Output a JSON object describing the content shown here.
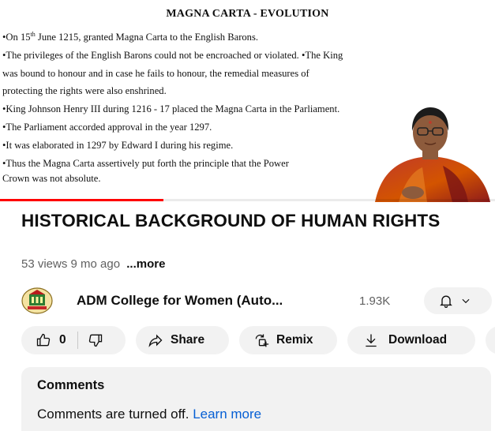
{
  "slide": {
    "title": "MAGNA CARTA - EVOLUTION",
    "line1_pre": "•On 15",
    "line1_sup": "th",
    "line1_post": " June 1215, granted Magna Carta to the English Barons.",
    "line2": "•The privileges of the English Barons could not be encroached or violated. •The King",
    "line3": "was bound to honour and in case he fails to honour, the remedial measures of",
    "line4": "protecting the rights were also enshrined.",
    "line5": "•King Johnson Henry III during 1216 - 17 placed the Magna Carta in the Parliament.",
    "line6": "•The Parliament accorded approval in the year 1297.",
    "line7": "•It was elaborated in 1297 by Edward I during his regime.",
    "line8": "•Thus the Magna Carta assertively put forth the principle that the Power",
    "line9": "Crown was not absolute."
  },
  "video": {
    "progress_fraction": 0.33,
    "progress_color": "#ff0000"
  },
  "details": {
    "title": "HISTORICAL BACKGROUND OF HUMAN RIGHTS",
    "views": "53 views",
    "age": "9 mo ago",
    "more": "...more"
  },
  "channel": {
    "name": "ADM College for Women (Auto...",
    "subscribers": "1.93K",
    "bell_icon": "bell-icon",
    "chevron_icon": "chevron-down-icon"
  },
  "actions": {
    "like_count": "0",
    "share": "Share",
    "remix": "Remix",
    "download": "Download"
  },
  "comments": {
    "heading": "Comments",
    "status": "Comments are turned off.",
    "learn_more": "Learn more",
    "link_color": "#065fd4"
  },
  "colors": {
    "pill_bg": "#f2f2f2",
    "secondary_text": "#606060"
  }
}
